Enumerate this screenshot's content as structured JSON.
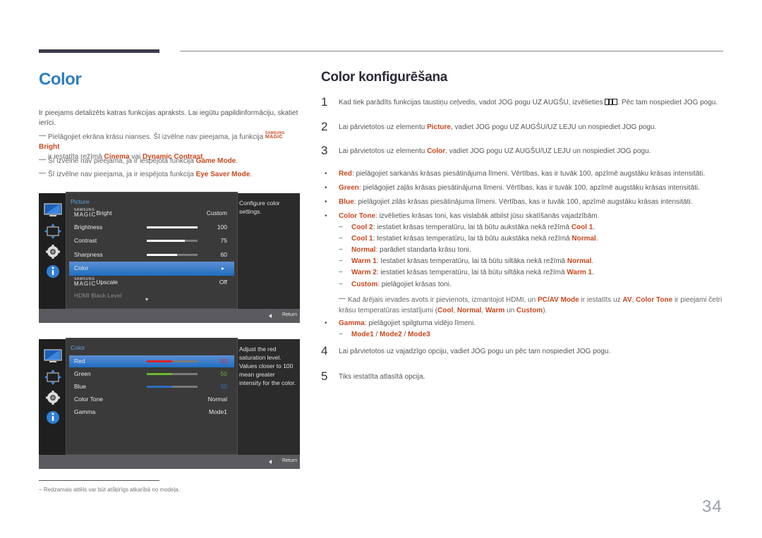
{
  "left": {
    "title": "Color",
    "intro": "Ir pieejams detalizēts katras funkcijas apraksts. Lai iegūtu papildinformāciju, skatiet ierīci.",
    "notes": [
      {
        "pre": "Pielāgojiet ekrāna krāsu nianses. Šī izvēlne nav pieejama, ja funkcija ",
        "logo_small": "SAMSUNG",
        "logo_big": "MAGIC",
        "hl1": "Bright",
        "mid": "ir iestatīta režīmā ",
        "hl2": "Cinema",
        "mid2": " vai ",
        "hl3": "Dynamic Contrast",
        "post": "."
      },
      {
        "pre": "Šī izvēlne nav pieejama, ja ir iespējota funkcija ",
        "hl1": "Game Mode",
        "post": "."
      },
      {
        "pre": "Šī izvēlne nav pieejama, ja ir iespējota funkcija ",
        "hl1": "Eye Saver Mode",
        "post": "."
      }
    ]
  },
  "osd1": {
    "header": "Picture",
    "help": "Configure color settings.",
    "return_label": "Return",
    "rows": [
      {
        "logo_small": "SAMSUNG",
        "logo_big": "MAGIC",
        "label": "Bright",
        "value": "Custom"
      },
      {
        "label": "Brightness",
        "value": "100",
        "level": 1.0
      },
      {
        "label": "Contrast",
        "value": "75",
        "level": 0.75
      },
      {
        "label": "Sharpness",
        "value": "60",
        "level": 0.6
      },
      {
        "label": "Color",
        "selected": true
      },
      {
        "logo_small": "SAMSUNG",
        "logo_big": "MAGIC",
        "label": "Upscale",
        "value": "Off"
      },
      {
        "label": "HDMI Black Level",
        "disabled": true
      }
    ]
  },
  "osd2": {
    "header": "Color",
    "help": "Adjust the red saturation level. Values closer to 100 mean greater intensity for the color.",
    "return_label": "Return",
    "rows": [
      {
        "label": "Red",
        "value": "50",
        "level": 0.5,
        "color": "#e0232a",
        "selected": true
      },
      {
        "label": "Green",
        "value": "50",
        "level": 0.5,
        "color": "#6ab82f"
      },
      {
        "label": "Blue",
        "value": "50",
        "level": 0.5,
        "color": "#2f6fc4"
      },
      {
        "label": "Color Tone",
        "value": "Normal"
      },
      {
        "label": "Gamma",
        "value": "Mode1"
      }
    ]
  },
  "right": {
    "title": "Color konfigurēšana",
    "steps": [
      {
        "num": "1",
        "pre": "Kad tiek parādīts funkcijas taustiņu ceļvedis, vadot JOG pogu UZ AUGŠU, izvēlieties ",
        "icon": "menu-icon",
        "post": ". Pēc tam nospiediet JOG pogu."
      },
      {
        "num": "2",
        "pre": "Lai pārvietotos uz elementu ",
        "hl": "Picture",
        "post": ", vadiet JOG pogu UZ AUGŠU/UZ LEJU un nospiediet JOG pogu."
      },
      {
        "num": "3",
        "pre": "Lai pārvietotos uz elementu ",
        "hl": "Color",
        "post": ", vadiet JOG pogu UZ AUGŠU/UZ LEJU un nospiediet JOG pogu."
      },
      {
        "num": "4",
        "text": "Lai pārvietotos uz vajadzīgo opciju, vadiet JOG pogu un pēc tam nospiediet JOG pogu."
      },
      {
        "num": "5",
        "text": "Tiks iestatīta atlasītā opcija."
      }
    ],
    "bullets": [
      {
        "hl": "Red",
        "text": ": pielāgojiet sarkanās krāsas piesātinājuma līmeni. Vērtības, kas ir tuvāk 100, apzīmē augstāku krāsas intensitāti."
      },
      {
        "hl": "Green",
        "text": ": pielāgojiet zaļās krāsas piesātinājuma līmeni. Vērtības, kas ir tuvāk 100, apzīmē augstāku krāsas intensitāti."
      },
      {
        "hl": "Blue",
        "text": ": pielāgojiet zilās krāsas piesātinājuma līmeni. Vērtības, kas ir tuvāk 100, apzīmē augstāku krāsas intensitāti."
      },
      {
        "hl": "Color Tone",
        "text": ": izvēlieties krāsas toni, kas vislabāk atbilst jūsu skatīšanās vajadzībām."
      },
      {
        "hl": "Gamma",
        "text": ": pielāgojiet spilgtuma vidējo līmeni."
      }
    ],
    "tones": [
      {
        "hl": "Cool 2",
        "text": ": iestatiet krāsas temperatūru, lai tā būtu aukstāka nekā režīmā ",
        "hl2": "Cool 1",
        "end": "."
      },
      {
        "hl": "Cool 1",
        "text": ": Iestatiet krāsas temperatūru, lai tā būtu aukstāka nekā režīmā ",
        "hl2": "Normal",
        "end": "."
      },
      {
        "hl": "Normal",
        "text": ": parādiet standarta krāsu toni.",
        "hl2": "",
        "end": ""
      },
      {
        "hl": "Warm 1",
        "text": ": Iestatiet krāsas temperatūru, lai tā būtu siltāka nekā režīmā ",
        "hl2": "Normal",
        "end": "."
      },
      {
        "hl": "Warm 2",
        "text": ": iestatiet krāsas temperatūru, lai tā būtu siltāka nekā režīmā ",
        "hl2": "Warm 1",
        "end": "."
      },
      {
        "hl": "Custom",
        "text": ": pielāgojiet krāsas toni.",
        "hl2": "",
        "end": ""
      }
    ],
    "note": {
      "p1": "Kad ārējais ievades avots ir pievienots, izmantojot HDMI, un ",
      "h1": "PC/AV Mode",
      "p2": " ir iestatīts uz ",
      "h2": "AV",
      "p3": ", ",
      "h3": "Color Tone",
      "p4": " ir pieejami četri krāsu temperatūras iestatījumi (",
      "h4": "Cool",
      "p5": ", ",
      "h5": "Normal",
      "p6": ", ",
      "h6": "Warm",
      "p7": " un ",
      "h7": "Custom",
      "p8": ")."
    },
    "gamma_modes": [
      "Mode1",
      "Mode2",
      "Mode3"
    ],
    "gamma_sep": " / "
  },
  "footer": {
    "note": "Redzamais attēls var būt atšķirīgs atkarībā no modeļa.",
    "page": "34"
  },
  "colors": {
    "accent_title": "#2f7fc0",
    "highlight": "#c8481f",
    "osd_select": "#1f6ec0"
  }
}
